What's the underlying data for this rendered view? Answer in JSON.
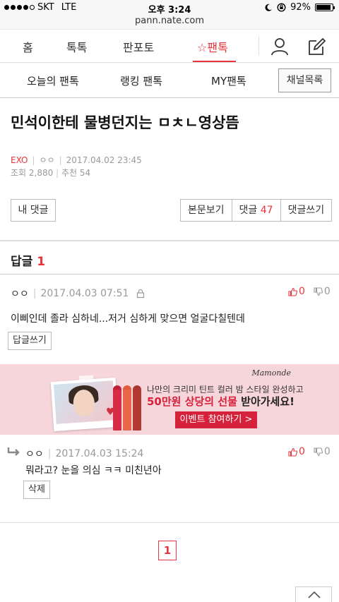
{
  "status_bar": {
    "carrier": "SKT",
    "network": "LTE",
    "time": "오후 3:24",
    "battery": "92%",
    "battery_level": 0.92
  },
  "url": "pann.nate.com",
  "gnb": {
    "items": [
      "홈",
      "톡톡",
      "판포토",
      "☆팬톡"
    ],
    "active_index": 3,
    "active_color": "#e8343b"
  },
  "subnav": {
    "items": [
      "오늘의 팬톡",
      "랭킹 팬톡",
      "MY팬톡"
    ],
    "channel_button": "채널목록"
  },
  "post": {
    "title": "민석이한테 물병던지는 ㅁㅊㄴ영상뜸",
    "channel": "EXO",
    "author": "ㅇㅇ",
    "date": "2017.04.02 23:45",
    "views": "조회 2,880",
    "recommend": "추천 54"
  },
  "buttons": {
    "my_comment": "내 댓글",
    "view_body": "본문보기",
    "comments_label": "댓글",
    "comments_count": "47",
    "write_comment": "댓글쓰기"
  },
  "replies": {
    "header_label": "답글",
    "header_count": "1",
    "main_comment": {
      "author": "ㅇㅇ",
      "date": "2017.04.03 07:51",
      "up": "0",
      "down": "0",
      "text": "이삐인데 졸라 심하네...저거 심하게 맞으면 얼굴다칠텐데",
      "reply_button": "답글쓰기"
    },
    "reply": {
      "author": "ㅇㅇ",
      "date": "2017.04.03 15:24",
      "up": "0",
      "down": "0",
      "text": "뭐라고? 눈을 의심 ㅋㅋ 미친년아",
      "delete_button": "삭제"
    }
  },
  "ad": {
    "brand": "Mamonde",
    "copy_line1": "나만의 크리미 틴트 컬러 밤 스타일 완성하고",
    "copy_highlight": "50만원 상당의 선물",
    "copy_rest": " 받아가세요!",
    "cta": "이벤트 참여하기",
    "cta_arrow": ">",
    "bg_color": "#f7d6db"
  },
  "pagination": {
    "current": "1"
  }
}
